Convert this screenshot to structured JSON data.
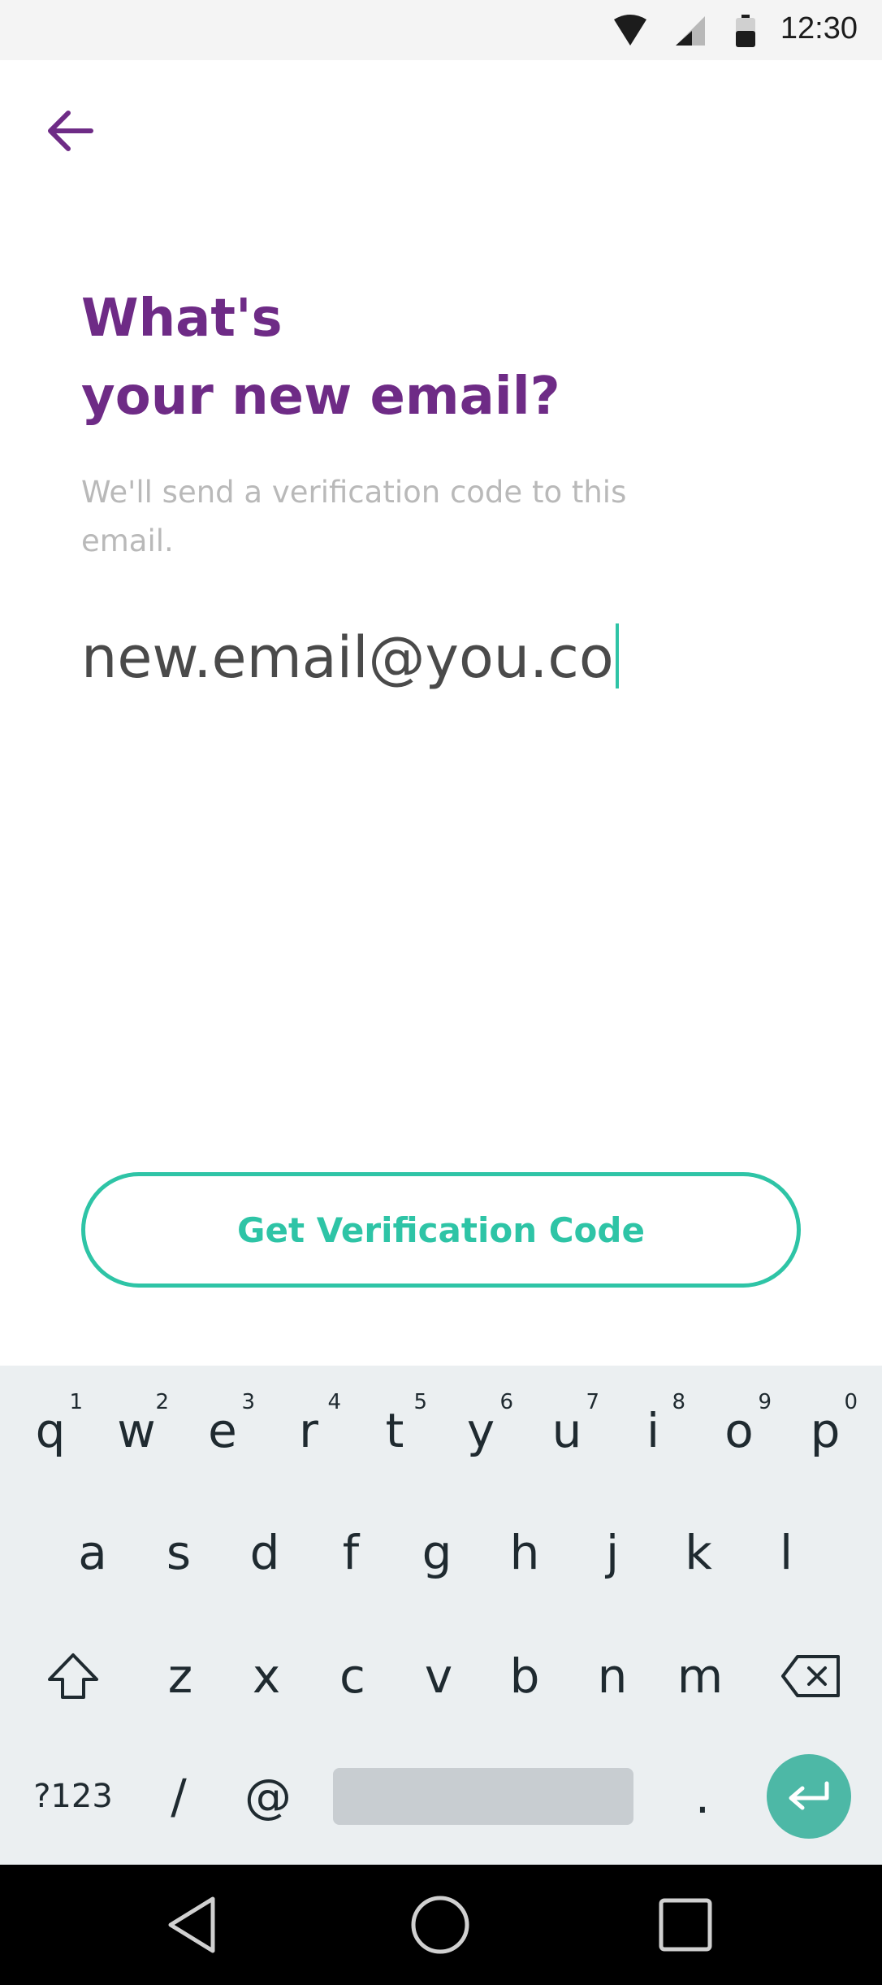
{
  "status_bar": {
    "time": "12:30",
    "icons": [
      "wifi-icon",
      "cell-signal-icon",
      "battery-icon"
    ]
  },
  "header": {
    "back_icon": "arrow-left-icon"
  },
  "main": {
    "title_line1": "What's",
    "title_line2": "your new email?",
    "subtitle": "We'll send a verification code to this email.",
    "email_value": "new.email@you.co",
    "cta_label": "Get Verification Code"
  },
  "colors": {
    "brand_purple": "#6e2b86",
    "accent_teal": "#2ec4a6",
    "muted_text": "#b9b9b9"
  },
  "keyboard": {
    "row1": [
      {
        "label": "q",
        "hint": "1"
      },
      {
        "label": "w",
        "hint": "2"
      },
      {
        "label": "e",
        "hint": "3"
      },
      {
        "label": "r",
        "hint": "4"
      },
      {
        "label": "t",
        "hint": "5"
      },
      {
        "label": "y",
        "hint": "6"
      },
      {
        "label": "u",
        "hint": "7"
      },
      {
        "label": "i",
        "hint": "8"
      },
      {
        "label": "o",
        "hint": "9"
      },
      {
        "label": "p",
        "hint": "0"
      }
    ],
    "row2": [
      "a",
      "s",
      "d",
      "f",
      "g",
      "h",
      "j",
      "k",
      "l"
    ],
    "row3": [
      "z",
      "x",
      "c",
      "v",
      "b",
      "n",
      "m"
    ],
    "row4": {
      "symbols": "?123",
      "slash": "/",
      "at": "@",
      "period": "."
    },
    "icons": [
      "shift-icon",
      "backspace-icon",
      "enter-icon"
    ]
  },
  "nav_bar": {
    "icons": [
      "back-triangle-icon",
      "home-circle-icon",
      "recents-square-icon"
    ]
  }
}
